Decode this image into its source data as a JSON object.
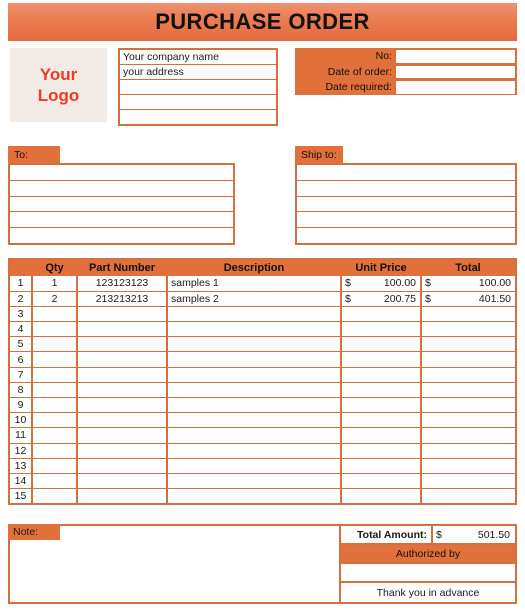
{
  "document": {
    "title": "PURCHASE ORDER"
  },
  "logo": {
    "line1": "Your",
    "line2": "Logo"
  },
  "company": {
    "rows": [
      "Your company name",
      "your address",
      "",
      "",
      ""
    ]
  },
  "order_info": {
    "rows": [
      {
        "label": "No:",
        "value": ""
      },
      {
        "label": "Date of order:",
        "value": ""
      },
      {
        "label": "Date required:",
        "value": ""
      }
    ]
  },
  "addresses": {
    "to_label": "To:",
    "ship_label": "Ship to:",
    "to_rows": [
      "",
      "",
      "",
      "",
      ""
    ],
    "ship_rows": [
      "",
      "",
      "",
      "",
      ""
    ]
  },
  "items_table": {
    "headers": {
      "num": "",
      "qty": "Qty",
      "part": "Part Number",
      "description": "Description",
      "unit_price": "Unit Price",
      "total": "Total"
    },
    "currency_symbol": "$",
    "rows": [
      {
        "num": "1",
        "qty": "1",
        "part": "123123123",
        "description": "samples 1",
        "unit_cur": "$",
        "unit": "100.00",
        "total_cur": "$",
        "total": "100.00"
      },
      {
        "num": "2",
        "qty": "2",
        "part": "213213213",
        "description": "samples 2",
        "unit_cur": "$",
        "unit": "200.75",
        "total_cur": "$",
        "total": "401.50"
      },
      {
        "num": "3",
        "qty": "",
        "part": "",
        "description": "",
        "unit_cur": "",
        "unit": "",
        "total_cur": "",
        "total": ""
      },
      {
        "num": "4",
        "qty": "",
        "part": "",
        "description": "",
        "unit_cur": "",
        "unit": "",
        "total_cur": "",
        "total": ""
      },
      {
        "num": "5",
        "qty": "",
        "part": "",
        "description": "",
        "unit_cur": "",
        "unit": "",
        "total_cur": "",
        "total": ""
      },
      {
        "num": "6",
        "qty": "",
        "part": "",
        "description": "",
        "unit_cur": "",
        "unit": "",
        "total_cur": "",
        "total": ""
      },
      {
        "num": "7",
        "qty": "",
        "part": "",
        "description": "",
        "unit_cur": "",
        "unit": "",
        "total_cur": "",
        "total": ""
      },
      {
        "num": "8",
        "qty": "",
        "part": "",
        "description": "",
        "unit_cur": "",
        "unit": "",
        "total_cur": "",
        "total": ""
      },
      {
        "num": "9",
        "qty": "",
        "part": "",
        "description": "",
        "unit_cur": "",
        "unit": "",
        "total_cur": "",
        "total": ""
      },
      {
        "num": "10",
        "qty": "",
        "part": "",
        "description": "",
        "unit_cur": "",
        "unit": "",
        "total_cur": "",
        "total": ""
      },
      {
        "num": "11",
        "qty": "",
        "part": "",
        "description": "",
        "unit_cur": "",
        "unit": "",
        "total_cur": "",
        "total": ""
      },
      {
        "num": "12",
        "qty": "",
        "part": "",
        "description": "",
        "unit_cur": "",
        "unit": "",
        "total_cur": "",
        "total": ""
      },
      {
        "num": "13",
        "qty": "",
        "part": "",
        "description": "",
        "unit_cur": "",
        "unit": "",
        "total_cur": "",
        "total": ""
      },
      {
        "num": "14",
        "qty": "",
        "part": "",
        "description": "",
        "unit_cur": "",
        "unit": "",
        "total_cur": "",
        "total": ""
      },
      {
        "num": "15",
        "qty": "",
        "part": "",
        "description": "",
        "unit_cur": "",
        "unit": "",
        "total_cur": "",
        "total": ""
      }
    ]
  },
  "footer": {
    "note_label": "Note:",
    "note_value": "",
    "total_amount_label": "Total Amount:",
    "total_amount_currency": "$",
    "total_amount_value": "501.50",
    "authorized_by_label": "Authorized by",
    "signature_value": "",
    "thanks_text": "Thank you in advance"
  },
  "colors": {
    "accent_orange": "#e2703a",
    "border_orange": "#d4703f",
    "title_gradient_top": "#ef9172",
    "title_gradient_bottom": "#e5693c",
    "logo_red": "#ee3b24",
    "logo_bg": "#f2ebe5"
  }
}
